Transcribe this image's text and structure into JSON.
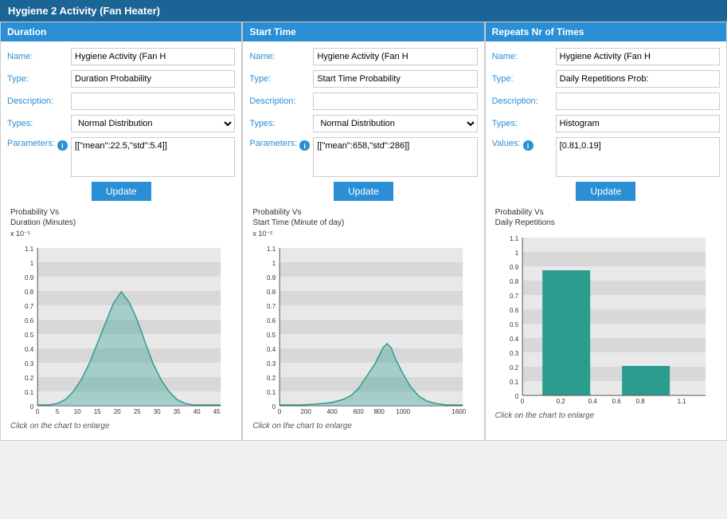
{
  "window": {
    "title": "Hygiene 2 Activity (Fan Heater)"
  },
  "panels": [
    {
      "id": "duration",
      "header": "Duration",
      "fields": {
        "name_label": "Name:",
        "name_value": "Hygiene Activity (Fan H",
        "type_label": "Type:",
        "type_value": "Duration Probability",
        "description_label": "Description:",
        "description_value": "",
        "types_label": "Types:",
        "types_value": "Normal Distribution",
        "params_label": "Parameters:",
        "params_value": "[[\"mean\":22.5,\"std\":5.4]]"
      },
      "button_label": "Update",
      "chart_title_line1": "Probability Vs",
      "chart_title_line2": "Duration (Minutes)",
      "chart_scale": "x 10⁻¹",
      "chart_y_labels": [
        "1.1",
        "1",
        "0.9",
        "0.8",
        "0.7",
        "0.6",
        "0.5",
        "0.4",
        "0.3",
        "0.2",
        "0.1",
        "0"
      ],
      "chart_x_labels": [
        "0",
        "5",
        "10",
        "15",
        "20",
        "25",
        "30",
        "35",
        "40",
        "45"
      ],
      "click_hint": "Click on the chart to enlarge",
      "chart_type": "bell"
    },
    {
      "id": "start_time",
      "header": "Start Time",
      "fields": {
        "name_label": "Name:",
        "name_value": "Hygiene Activity (Fan H",
        "type_label": "Type:",
        "type_value": "Start Time Probability",
        "description_label": "Description:",
        "description_value": "",
        "types_label": "Types:",
        "types_value": "Normal Distribution",
        "params_label": "Parameters:",
        "params_value": "[[\"mean\":658,\"std\":286]]"
      },
      "button_label": "Update",
      "chart_title_line1": "Probability Vs",
      "chart_title_line2": "Start Time (Minute of day)",
      "chart_scale": "x 10⁻²",
      "chart_y_labels": [
        "1.1",
        "1",
        "0.9",
        "0.8",
        "0.7",
        "0.6",
        "0.5",
        "0.4",
        "0.3",
        "0.2",
        "0.1",
        "0"
      ],
      "chart_x_labels": [
        "0",
        "200",
        "400",
        "600",
        "800",
        "1000",
        "1600"
      ],
      "click_hint": "Click on the chart to enlarge",
      "chart_type": "bell_wide"
    },
    {
      "id": "repeats",
      "header": "Repeats Nr of Times",
      "fields": {
        "name_label": "Name:",
        "name_value": "Hygiene Activity (Fan H",
        "type_label": "Type:",
        "type_value": "Daily Repetitions Prob:",
        "description_label": "Description:",
        "description_value": "",
        "types_label": "Types:",
        "types_value": "Histogram",
        "values_label": "Values:",
        "values_value": "[0.81,0.19]"
      },
      "button_label": "Update",
      "chart_title_line1": "Probability Vs",
      "chart_title_line2": "Daily Repetitions",
      "chart_scale": "",
      "chart_y_labels": [
        "1.1",
        "1",
        "0.9",
        "0.8",
        "0.7",
        "0.6",
        "0.5",
        "0.4",
        "0.3",
        "0.2",
        "0.1",
        "0"
      ],
      "chart_x_labels": [
        "0",
        "0.2",
        "0.4",
        "0.6",
        "0.8",
        "1.1"
      ],
      "click_hint": "Click on the chart to enlarge",
      "chart_type": "histogram",
      "histogram_data": [
        0.81,
        0.19
      ]
    }
  ],
  "info_icon_label": "i"
}
